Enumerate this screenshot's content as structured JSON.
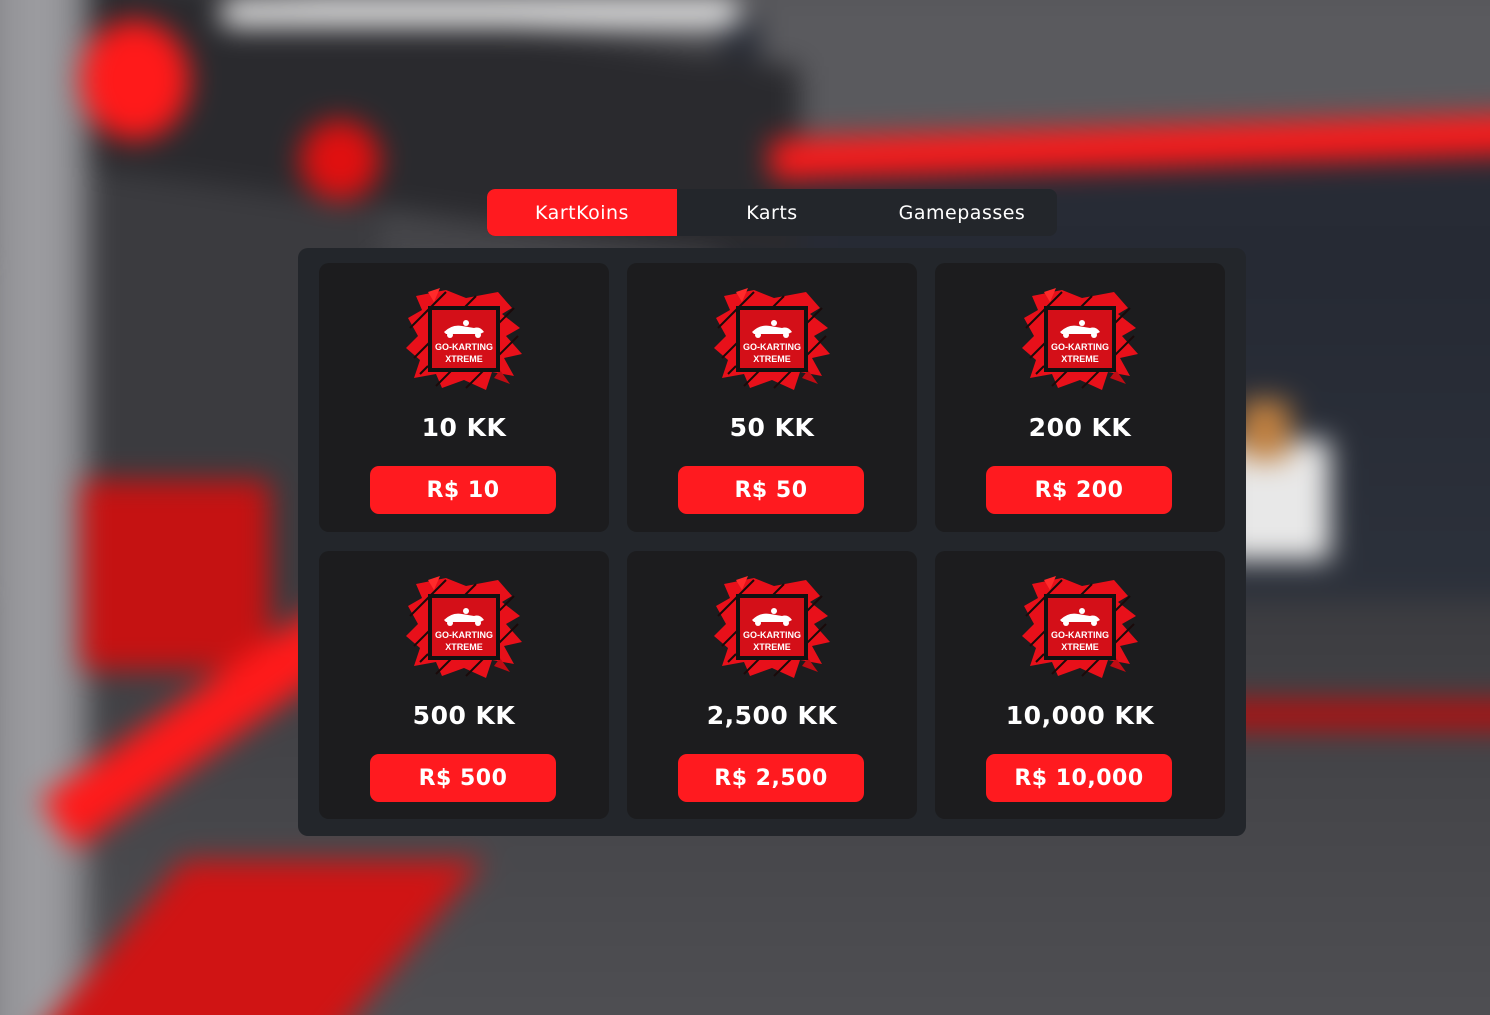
{
  "tabs": [
    {
      "label": "KartKoins",
      "active": true
    },
    {
      "label": "Karts",
      "active": false
    },
    {
      "label": "Gamepasses",
      "active": false
    }
  ],
  "logo": {
    "icon": "go-karting-xtreme-logo",
    "line1": "GO-KARTING",
    "line2": "XTREME"
  },
  "products": [
    {
      "amount": "10 KK",
      "price": "R$ 10"
    },
    {
      "amount": "50 KK",
      "price": "R$ 50"
    },
    {
      "amount": "200 KK",
      "price": "R$ 200"
    },
    {
      "amount": "500 KK",
      "price": "R$ 500"
    },
    {
      "amount": "2,500 KK",
      "price": "R$ 2,500"
    },
    {
      "amount": "10,000 KK",
      "price": "R$ 10,000"
    }
  ],
  "colors": {
    "accent": "#ff1a1f",
    "panel": "#23262b",
    "card": "#1c1c1e",
    "text": "#ffffff"
  }
}
